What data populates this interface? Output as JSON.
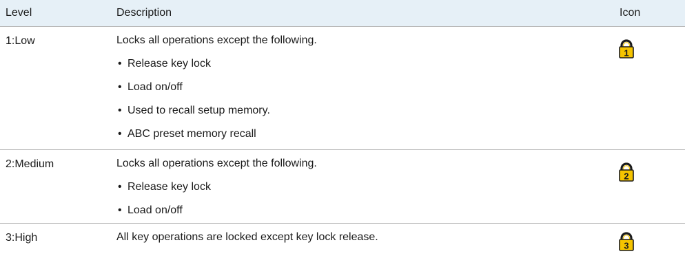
{
  "table": {
    "headers": {
      "level": "Level",
      "description": "Description",
      "icon": "Icon"
    },
    "rows": [
      {
        "level": "1:Low",
        "description": "Locks all operations except the following.",
        "bullets": [
          "Release key lock",
          "Load on/off",
          "Used to recall setup memory.",
          "ABC preset memory recall"
        ],
        "icon_name": "lock-level-1-icon",
        "icon_digit": "1"
      },
      {
        "level": "2:Medium",
        "description": "Locks all operations except the following.",
        "bullets": [
          "Release key lock",
          "Load on/off"
        ],
        "icon_name": "lock-level-2-icon",
        "icon_digit": "2"
      },
      {
        "level": "3:High",
        "description": "All key operations are locked except key lock release.",
        "bullets": [],
        "icon_name": "lock-level-3-icon",
        "icon_digit": "3"
      }
    ],
    "colors": {
      "header_bg": "#e6f0f7",
      "border": "#b9b9b9",
      "icon_yellow": "#f5c400",
      "icon_dark": "#1b1b1b"
    }
  }
}
